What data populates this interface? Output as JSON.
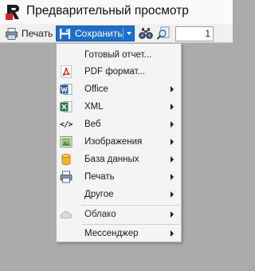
{
  "window": {
    "title": "Предварительный просмотр",
    "logo_icon": "fastreport-logo-icon"
  },
  "toolbar": {
    "print_label": "Печать",
    "print_icon": "printer-icon",
    "save_label": "Сохранить",
    "save_icon": "floppy-disk-icon",
    "find_icon": "binoculars-icon",
    "zoom_icon": "magnifier-page-icon",
    "page_value": "1",
    "accent_color": "#1e6fc7"
  },
  "save_menu": {
    "items": [
      {
        "label": "Готовый отчет...",
        "icon": "",
        "has_submenu": false
      },
      {
        "label": "PDF формат...",
        "icon": "pdf-icon",
        "has_submenu": false
      },
      {
        "label": "Office",
        "icon": "word-icon",
        "has_submenu": true
      },
      {
        "label": "XML",
        "icon": "excel-icon",
        "has_submenu": true
      },
      {
        "label": "Веб",
        "icon": "code-tag-icon",
        "icon_text": "</>",
        "has_submenu": true
      },
      {
        "label": "Изображения",
        "icon": "image-icon",
        "has_submenu": true
      },
      {
        "label": "База данных",
        "icon": "database-icon",
        "has_submenu": true
      },
      {
        "label": "Печать",
        "icon": "printer-icon",
        "has_submenu": true
      },
      {
        "label": "Другое",
        "icon": "",
        "has_submenu": true
      },
      {
        "label": "Облако",
        "icon": "cloud-icon",
        "has_submenu": true
      },
      {
        "label": "Мессенджер",
        "icon": "",
        "has_submenu": true
      }
    ]
  }
}
